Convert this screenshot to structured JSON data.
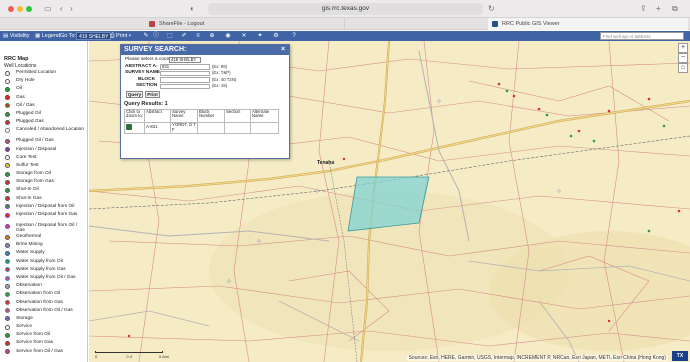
{
  "browser": {
    "url": "gis.rrc.texas.gov",
    "tabs": [
      {
        "label": "ShareFile - Logout"
      },
      {
        "label": "RRC Public GIS Viewer"
      }
    ]
  },
  "toolbar": {
    "visibility_label": "Visibility",
    "legend_label": "Legend",
    "goto_label": "Go To:",
    "goto_value": "419 SHELBY",
    "print_label": "Print",
    "search_placeholder": "Find well api or address"
  },
  "legend": {
    "title": "RRC Map",
    "subtitle": "Well Locations",
    "items": [
      {
        "label": "Permitted Location",
        "color": "#ffffff",
        "border": "#555"
      },
      {
        "label": "Dry Hole",
        "color": "#ffffff",
        "border": "#555"
      },
      {
        "label": "Oil",
        "color": "#2e9e3a",
        "border": "#1c6e25"
      },
      {
        "label": "Gas",
        "color": "#d9312c",
        "border": "#9a1d1a"
      },
      {
        "label": "Oil / Gas",
        "color": "#d9312c",
        "border": "#2e9e3a"
      },
      {
        "label": "Plugged Oil",
        "color": "#2e9e3a",
        "border": "#555"
      },
      {
        "label": "Plugged Gas",
        "color": "#d9312c",
        "border": "#555"
      },
      {
        "label": "Canceled / Abandoned Location",
        "color": "#ffffff",
        "border": "#777",
        "tall": true
      },
      {
        "label": "Plugged Oil / Gas",
        "color": "#c94a8c",
        "border": "#555"
      },
      {
        "label": "Injection / Disposal",
        "color": "#8a3ab9",
        "border": "#555"
      },
      {
        "label": "Core Test",
        "color": "#ffffff",
        "border": "#555"
      },
      {
        "label": "Sulfur Test",
        "color": "#e8d22e",
        "border": "#555"
      },
      {
        "label": "Storage from Oil",
        "color": "#2e9e3a",
        "border": "#555"
      },
      {
        "label": "Storage from Gas",
        "color": "#d9312c",
        "border": "#555"
      },
      {
        "label": "Shut-In Oil",
        "color": "#2e9e3a",
        "border": "#555"
      },
      {
        "label": "Shut-In Gas",
        "color": "#d9312c",
        "border": "#555"
      },
      {
        "label": "Injection / Disposal from Oil",
        "color": "#2e9e3a",
        "border": "#8a3ab9"
      },
      {
        "label": "Injection / Disposal from Gas",
        "color": "#d9312c",
        "border": "#8a3ab9",
        "tall": true
      },
      {
        "label": "Injection / Disposal from Oil / Gas",
        "color": "#c94a8c",
        "border": "#8a3ab9",
        "tall": true
      },
      {
        "label": "Geothermal",
        "color": "#e27b1e",
        "border": "#555"
      },
      {
        "label": "Brine Mining",
        "color": "#8888cc",
        "border": "#555"
      },
      {
        "label": "Water Supply",
        "color": "#3a86d9",
        "border": "#555"
      },
      {
        "label": "Water Supply from Oil",
        "color": "#2e9e3a",
        "border": "#3a86d9"
      },
      {
        "label": "Water Supply from Gas",
        "color": "#d9312c",
        "border": "#3a86d9"
      },
      {
        "label": "Water Supply from Oil / Gas",
        "color": "#c94a8c",
        "border": "#3a86d9"
      },
      {
        "label": "Observation",
        "color": "#aaaaaa",
        "border": "#555"
      },
      {
        "label": "Observation from Oil",
        "color": "#2e9e3a",
        "border": "#777"
      },
      {
        "label": "Observation from Gas",
        "color": "#d9312c",
        "border": "#777"
      },
      {
        "label": "Observation from Oil / Gas",
        "color": "#c94a8c",
        "border": "#777"
      },
      {
        "label": "Storage",
        "color": "#6f6fcf",
        "border": "#555"
      },
      {
        "label": "Service",
        "color": "#ffffff",
        "border": "#555"
      },
      {
        "label": "Service from Oil",
        "color": "#2e9e3a",
        "border": "#555"
      },
      {
        "label": "Service from Gas",
        "color": "#d9312c",
        "border": "#555"
      },
      {
        "label": "Service from Oil / Gas",
        "color": "#c94a8c",
        "border": "#555"
      }
    ]
  },
  "dialog": {
    "title": "SURVEY SEARCH:",
    "county_prompt": "Please select a county:",
    "county_value": "419 SHELBY",
    "fields": [
      {
        "label": "ABSTRACT A-",
        "value": "831",
        "hint": "(Ex: 99)"
      },
      {
        "label": "SURVEY NAME",
        "value": "",
        "hint": "(Ex: T&P)"
      },
      {
        "label": "BLOCK",
        "value": "",
        "hint": "(Ex: 40 T2N)"
      },
      {
        "label": "SECTION",
        "value": "",
        "hint": "(Ex: 19)"
      }
    ],
    "query_label": "Query",
    "print_label": "Print",
    "results_label": "Query Results:",
    "results_count": "1",
    "columns": [
      "Click to Zoom to:",
      "Abstract",
      "Survey Name",
      "Block Number",
      "Section",
      "Alternate Name"
    ],
    "rows": [
      {
        "abstract": "A-831",
        "survey": "YORDT, D T F",
        "block": "",
        "section": "",
        "alternate": ""
      }
    ]
  },
  "map": {
    "town_label": "Tenaha",
    "attribution": "Sources: Esri, HERE, Garmin, USGS, Intermap, INCREMENT P, NRCan, Esri Japan, METI, Esri China (Hong Kong)",
    "scale_labels": [
      "0",
      "0.3",
      "0.6mi"
    ],
    "highlight_color": "#7fd3d3"
  }
}
